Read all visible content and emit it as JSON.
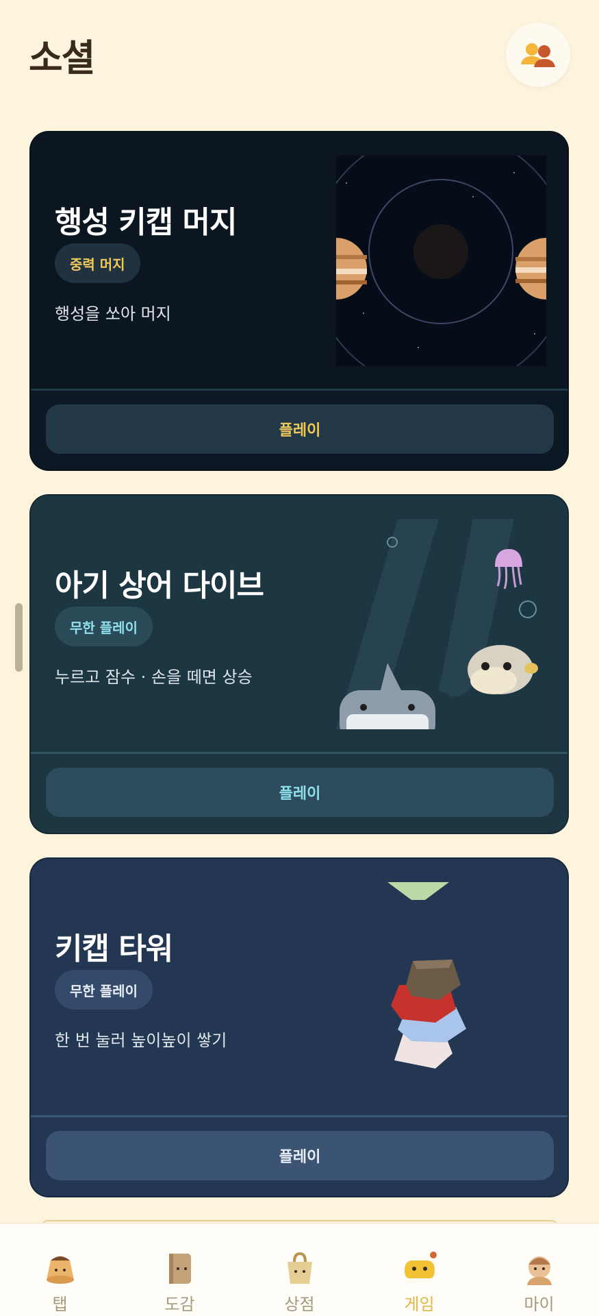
{
  "header": {
    "title": "소셜",
    "social_icon": "friends-icon"
  },
  "games": [
    {
      "title": "행성 키캡 머지",
      "badge": "중력 머지",
      "description": "행성을 쏘아 머지",
      "play_label": "플레이",
      "colors": {
        "bg": "#0c1924",
        "accent": "#f0c95a",
        "badge_bg": "#20323f",
        "button_bg": "#233846"
      }
    },
    {
      "title": "아기 상어 다이브",
      "badge": "무한 플레이",
      "description": "누르고 잠수 · 손을 떼면 상승",
      "play_label": "플레이",
      "colors": {
        "bg": "#1c3642",
        "accent": "#8fe0ea",
        "badge_bg": "#2a4a58",
        "button_bg": "#2c4b5d"
      }
    },
    {
      "title": "키캡 타워",
      "badge": "무한 플레이",
      "description": "한 번 눌러 높이높이 쌓기",
      "play_label": "플레이",
      "colors": {
        "bg": "#233652",
        "accent": "#e9eef6",
        "badge_bg": "#344a6a",
        "button_bg": "#3b5474"
      }
    }
  ],
  "nav": {
    "items": [
      {
        "label": "탭",
        "icon": "pudding-icon",
        "active": false
      },
      {
        "label": "도감",
        "icon": "book-icon",
        "active": false
      },
      {
        "label": "상점",
        "icon": "shopping-bag-icon",
        "active": false
      },
      {
        "label": "게임",
        "icon": "gamepad-icon",
        "active": true
      },
      {
        "label": "마이",
        "icon": "profile-icon",
        "active": false
      }
    ],
    "active_color": "#e2b548",
    "inactive_color": "#a6997e"
  }
}
